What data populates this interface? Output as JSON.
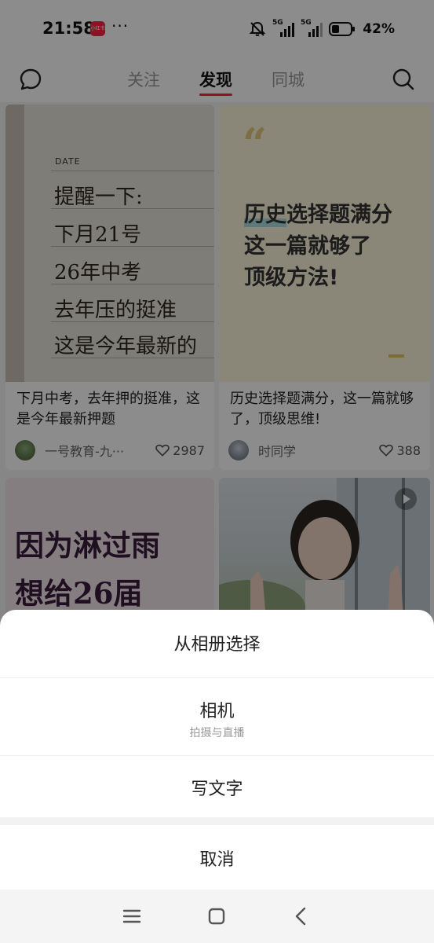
{
  "status_bar": {
    "time": "21:58",
    "app_badge": "小红书",
    "more": "···",
    "net1": "5G",
    "net2": "5G",
    "battery": "42%",
    "battery_level": 0.42
  },
  "top_nav": {
    "tabs": [
      {
        "label": "关注",
        "active": false
      },
      {
        "label": "发现",
        "active": true
      },
      {
        "label": "同城",
        "active": false
      }
    ],
    "accent": "#ff2442"
  },
  "feed": {
    "cards": [
      {
        "image_text": {
          "date_label": "DATE",
          "lines": [
            "提醒一下:",
            "下月21号",
            "26年中考",
            "去年压的挺准",
            "这是今年最新的"
          ]
        },
        "title": "下月中考，去年押的挺准，这是今年最新押题",
        "author": "一号教育-九···",
        "likes": "2987"
      },
      {
        "image_text": {
          "quote": "“",
          "line1_highlight": "历史",
          "line1_rest": "选择题满分",
          "line2": "这一篇就够了",
          "line3": "顶级方法!"
        },
        "title": "历史选择题满分，这一篇就够了，顶级思维!",
        "author": "时同学",
        "likes": "388"
      },
      {
        "image_text": {
          "lines": [
            "因为淋过雨",
            "想给26届"
          ]
        }
      },
      {
        "has_video": true
      }
    ]
  },
  "sheet": {
    "items": [
      {
        "label": "从相册选择"
      },
      {
        "label": "相机",
        "sub": "拍摄与直播"
      },
      {
        "label": "写文字"
      }
    ],
    "cancel": "取消"
  },
  "icons": {
    "chat": "chat-bubble-icon",
    "search": "search-icon",
    "like": "heart-icon",
    "menu": "menu-icon",
    "home": "home-icon",
    "back": "back-icon"
  }
}
